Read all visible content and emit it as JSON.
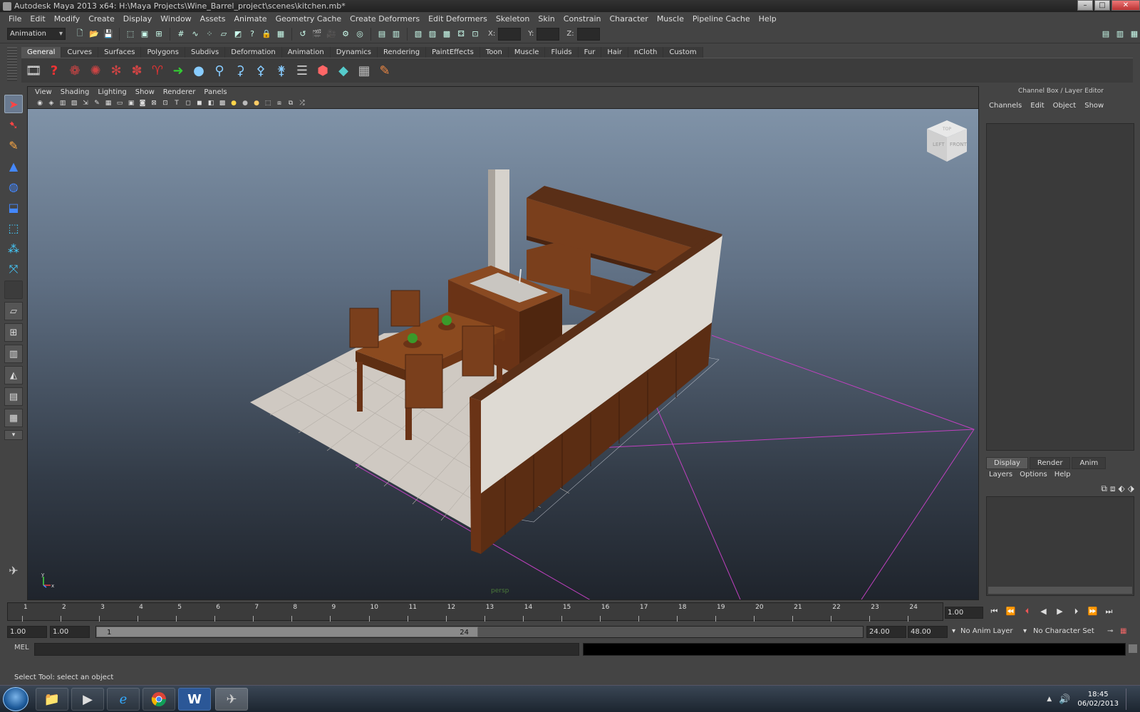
{
  "window": {
    "title": "Autodesk Maya 2013 x64: H:\\Maya Projects\\Wine_Barrel_project\\scenes\\kitchen.mb*",
    "controls": [
      "minimize",
      "maximize",
      "close"
    ]
  },
  "menubar": {
    "items": [
      "File",
      "Edit",
      "Modify",
      "Create",
      "Display",
      "Window",
      "Assets",
      "Animate",
      "Geometry Cache",
      "Create Deformers",
      "Edit Deformers",
      "Skeleton",
      "Skin",
      "Constrain",
      "Character",
      "Muscle",
      "Pipeline Cache",
      "Help"
    ]
  },
  "statusline": {
    "mode": "Animation",
    "x_label": "X:",
    "y_label": "Y:",
    "z_label": "Z:",
    "x_value": "",
    "y_value": "",
    "z_value": ""
  },
  "shelf": {
    "tabs": [
      "General",
      "Curves",
      "Surfaces",
      "Polygons",
      "Subdivs",
      "Deformation",
      "Animation",
      "Dynamics",
      "Rendering",
      "PaintEffects",
      "Toon",
      "Muscle",
      "Fluids",
      "Fur",
      "Hair",
      "nCloth",
      "Custom"
    ],
    "active_tab": "General"
  },
  "viewport": {
    "menu": [
      "View",
      "Shading",
      "Lighting",
      "Show",
      "Renderer",
      "Panels"
    ],
    "camera_label": "persp",
    "viewcube_faces": [
      "LEFT",
      "FRONT",
      "TOP"
    ],
    "axis_labels": [
      "y",
      "x"
    ]
  },
  "right_panel": {
    "title": "Channel Box / Layer Editor",
    "channel_menu": [
      "Channels",
      "Edit",
      "Object",
      "Show"
    ],
    "layer_tabs": [
      "Display",
      "Render",
      "Anim"
    ],
    "active_layer_tab": "Display",
    "layer_menu": [
      "Layers",
      "Options",
      "Help"
    ]
  },
  "timeline": {
    "ticks": [
      "1",
      "2",
      "3",
      "4",
      "5",
      "6",
      "7",
      "8",
      "9",
      "10",
      "11",
      "12",
      "13",
      "14",
      "15",
      "16",
      "17",
      "18",
      "19",
      "20",
      "21",
      "22",
      "23",
      "24"
    ],
    "current_time": "1.00",
    "start_time": "1.00",
    "playback_start": "1.00",
    "range_start": "1",
    "range_end": "24",
    "playback_end": "24.00",
    "end_time": "48.00",
    "anim_layer": "No Anim Layer",
    "character_set": "No Character Set"
  },
  "command_line": {
    "language": "MEL",
    "input": "",
    "output": ""
  },
  "help_line": {
    "text": "Select Tool: select an object"
  },
  "taskbar": {
    "apps": [
      "windows-explorer",
      "media-player",
      "internet-explorer",
      "chrome",
      "word",
      "maya"
    ],
    "active_app": "maya",
    "time": "18:45",
    "date": "06/02/2013"
  },
  "colors": {
    "viewport_top": "#8093a8",
    "viewport_bottom": "#1f242c",
    "grid_boundary": "#c040c0",
    "wood": "#7a3f1c",
    "wall": "#d9d6d0"
  }
}
